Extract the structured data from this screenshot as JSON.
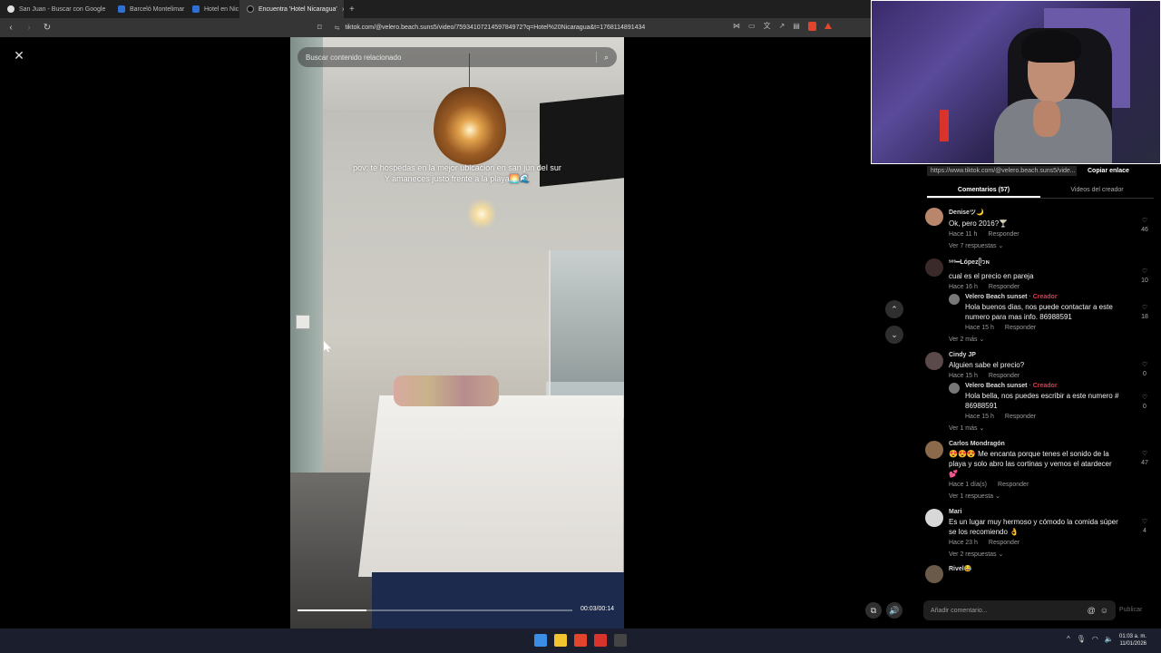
{
  "browser": {
    "tabs": [
      {
        "label": "San Juan - Buscar con Google",
        "icon": "google-icon",
        "active": false
      },
      {
        "label": "Barceló Montelimar",
        "icon": "page-icon",
        "active": false
      },
      {
        "label": "Hotel en Nic",
        "icon": "page-icon",
        "active": false
      },
      {
        "label": "Encuentra 'Hotel Nicaragua'",
        "icon": "tiktok-icon",
        "active": true
      }
    ],
    "new_tab": "+",
    "tab_close": "×",
    "url": "tiktok.com/@velero.beach.suns5/video/7593410721459784972?q=Hotel%20Nicaragua&t=1768114891434",
    "nav": {
      "back": "‹",
      "forward": "›",
      "reload": "↻",
      "bookmark": "⌑",
      "site_info": "⇆"
    }
  },
  "video": {
    "close": "✕",
    "search_placeholder": "Buscar contenido relacionado",
    "search_icon": "⌕",
    "caption_line1": "pov: te hospedas en la mejor ubicación en san jun del sur",
    "caption_line2": "Y amaneces justo frente a la playa🌅🌊",
    "time": "00:03/00:14",
    "progress": 0.25
  },
  "controls": {
    "up": "⌃",
    "down": "⌄",
    "autoscroll": "⧉",
    "volume": "🔊"
  },
  "panel": {
    "url": "https://www.tiktok.com/@velero.beach.suns5/vide...",
    "copy_link": "Copiar enlace",
    "tab_comments": "Comentarios (57)",
    "tab_creator": "Videos del creador",
    "comments": [
      {
        "user": "Deniseツ🌙",
        "text": "Ok, pero 2016?🍸",
        "time": "Hace 11 h",
        "reply": "Responder",
        "likes": "46",
        "more": "Ver 7 respuestas ⌄"
      },
      {
        "user": "ˢᵒˢ━Lópezᥫ᭡ɴ",
        "text": "cual es el precio en pareja",
        "time": "Hace 16 h",
        "reply": "Responder",
        "likes": "10",
        "sub": {
          "user": "Velero Beach sunset",
          "badge": "· Creador",
          "text": "Hola buenos dias, nos puede contactar a este numero para mas info. 86988591",
          "time": "Hace 15 h",
          "reply": "Responder",
          "likes": "18"
        },
        "more": "Ver 2 más ⌄"
      },
      {
        "user": "Cindy JP",
        "text": "Alguien sabe el precio?",
        "time": "Hace 15 h",
        "reply": "Responder",
        "likes": "0",
        "sub": {
          "user": "Velero Beach sunset",
          "badge": "· Creador",
          "text": "Hola bella, nos puedes escribir a este numero # 86988591",
          "time": "Hace 15 h",
          "reply": "Responder",
          "likes": "0"
        },
        "more": "Ver 1 más ⌄"
      },
      {
        "user": "Carlos Mondragón",
        "text": "😍😍😍 Me encanta porque tenes el sonido de la playa y solo abro las cortinas y vemos el atardecer 💕",
        "time": "Hace 1 día(s)",
        "reply": "Responder",
        "likes": "47",
        "more": "Ver 1 respuesta ⌄"
      },
      {
        "user": "Mari",
        "text": "Es un lugar muy hermoso y cómodo la comida súper se los recomiendo 👌",
        "time": "Hace 23 h",
        "reply": "Responder",
        "likes": "4",
        "more": "Ver 2 respuestas ⌄"
      },
      {
        "user": "Rivel😂",
        "text": "",
        "time": "",
        "reply": "",
        "likes": "",
        "more": ""
      }
    ],
    "composer_placeholder": "Añadir comentario...",
    "mention_icon": "@",
    "emoji_icon": "☺",
    "publish": "Publicar",
    "heart": "♡"
  },
  "taskbar": {
    "clock_time": "01:03 a. m.",
    "clock_date": "11/01/2026",
    "tray_caret": "^",
    "app_colors": [
      "#3a8ee6",
      "#f4c430",
      "#e2452c",
      "#d9342b",
      "#444"
    ]
  }
}
